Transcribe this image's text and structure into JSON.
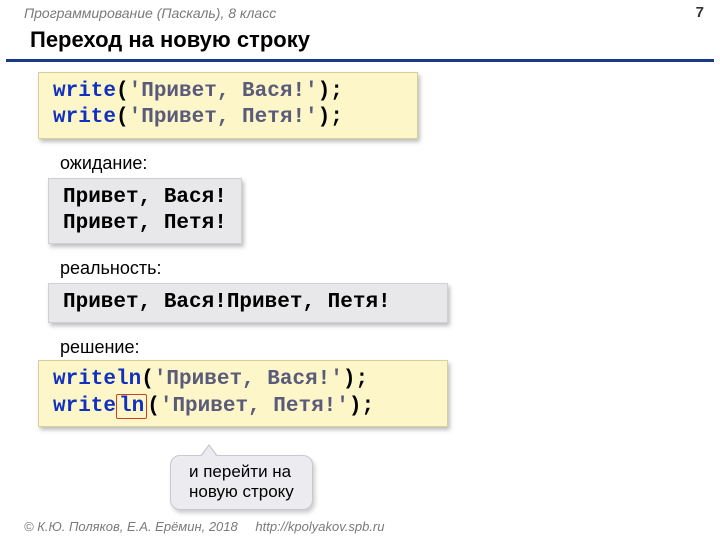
{
  "header": {
    "course": "Программирование (Паскаль), 8 класс",
    "page": "7"
  },
  "title": "Переход на новую строку",
  "code1": {
    "kw1": "write",
    "p1": "(",
    "s1": "'Привет, Вася!'",
    "p2": ");",
    "kw2": "write",
    "p3": "(",
    "s2": "'Привет, Петя!'",
    "p4": ");"
  },
  "labels": {
    "expect": "ожидание:",
    "reality": "реальность:",
    "solution": "решение:"
  },
  "expect_out": {
    "l1": "Привет, Вася!",
    "l2": "Привет, Петя!"
  },
  "reality_out": "Привет, Вася!Привет, Петя!",
  "code2": {
    "kw1": "writeln",
    "p1": "(",
    "s1": "'Привет, Вася!'",
    "p2": ");",
    "kw2a": "write",
    "kw2b": "ln",
    "p3": "(",
    "s2": "'Привет, Петя!'",
    "p4": ");"
  },
  "callout": {
    "l1": "и перейти на",
    "l2": "новую строку"
  },
  "footer": {
    "copyright": "© К.Ю. Поляков, Е.А. Ерёмин, 2018",
    "url": "http://kpolyakov.spb.ru"
  }
}
